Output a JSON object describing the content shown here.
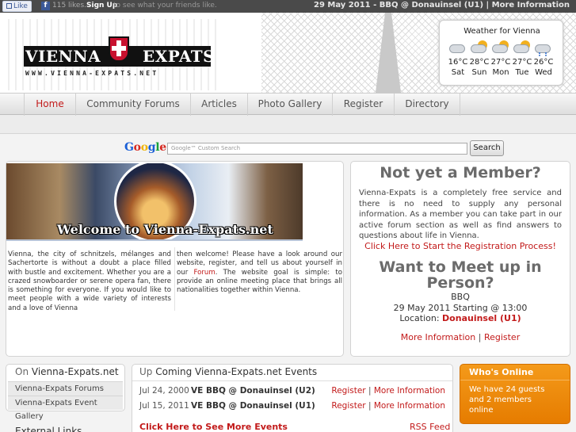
{
  "topbar": {
    "like_label": "Like",
    "fb_letter": "f",
    "likes_count": "115 likes.",
    "signup_label": "Sign Up",
    "signup_rest": "to see what your friends like.",
    "news": "29 May 2011 - BBQ @ Donauinsel (U1) | More Information"
  },
  "logo": {
    "word1": "VIENNA",
    "word2": "EXPATS",
    "url": "WWW.VIENNA-EXPATS.NET"
  },
  "weather": {
    "title": "Weather for Vienna",
    "days": [
      {
        "temp": "16°C",
        "day": "Sat",
        "icon": "cloudy-icon"
      },
      {
        "temp": "28°C",
        "day": "Sun",
        "icon": "partly-cloudy-icon"
      },
      {
        "temp": "27°C",
        "day": "Mon",
        "icon": "partly-cloudy-icon"
      },
      {
        "temp": "27°C",
        "day": "Tue",
        "icon": "partly-cloudy-icon"
      },
      {
        "temp": "26°C",
        "day": "Wed",
        "icon": "rain-icon"
      }
    ]
  },
  "nav": {
    "items": [
      "Home",
      "Community Forums",
      "Articles",
      "Photo Gallery",
      "Register",
      "Directory"
    ],
    "active": "Home"
  },
  "search": {
    "google_letters": [
      "G",
      "o",
      "o",
      "g",
      "l",
      "e"
    ],
    "placeholder": "Google™ Custom Search",
    "button": "Search"
  },
  "welcome": {
    "banner_caption": "Welcome to Vienna-Expats.net",
    "text_left": "Vienna, the city of schnitzels, mélanges and Sachertorte is without a doubt a place filled with bustle and excitement. Whether you are a crazed snowboarder or serene opera fan, there is something for everyone. If you would like to meet people with a wide variety of interests and a love of Vienna",
    "text_right_before": "then welcome! Please have a look around our website, register, and tell us about yourself in our",
    "text_right_link": "Forum",
    "text_right_after": ". The website goal is simple: to provide an online meeting place that brings all nationalities together within Vienna."
  },
  "member": {
    "title": "Not yet a Member?",
    "body": "Vienna-Expats is a completely free service and there is no need to supply any personal information. As a member you can take part in our active forum section as well as find answers to questions about life in Vienna.",
    "register_link": "Click Here to Start the Registration Process!"
  },
  "meet": {
    "title": "Want to Meet up in Person?",
    "event": "BBQ",
    "when": "29 May 2011 Starting @ 13:00",
    "location_label": "Location:",
    "location": "Donauinsel (U1)",
    "more_info": "More Information",
    "sep": "|",
    "register": "Register"
  },
  "left_box": {
    "title_prefix": "On",
    "title": "Vienna-Expats.net",
    "links": [
      "Vienna-Expats Forums",
      "Vienna-Expats Event Gallery"
    ],
    "external_title": "External Links"
  },
  "events": {
    "title_prefix": "Up",
    "title": "Coming Vienna-Expats.net Events",
    "rows": [
      {
        "date": "Jul 24, 2000",
        "name": "VE BBQ @ Donauinsel (U2)",
        "register": "Register",
        "sep": "|",
        "more": "More Information"
      },
      {
        "date": "Jul 15, 2011",
        "name": "VE BBQ @ Donauinsel (U1)",
        "register": "Register",
        "sep": "|",
        "more": "More Information"
      }
    ],
    "more_link": "Click Here to See More Events",
    "rss": "RSS Feed"
  },
  "online": {
    "title": "Who's Online",
    "text": "We have 24 guests and 2 members online"
  },
  "colors": {
    "accent_red": "#c21a1a",
    "orange": "#f49a1a",
    "topbar": "#4a4a4a"
  }
}
